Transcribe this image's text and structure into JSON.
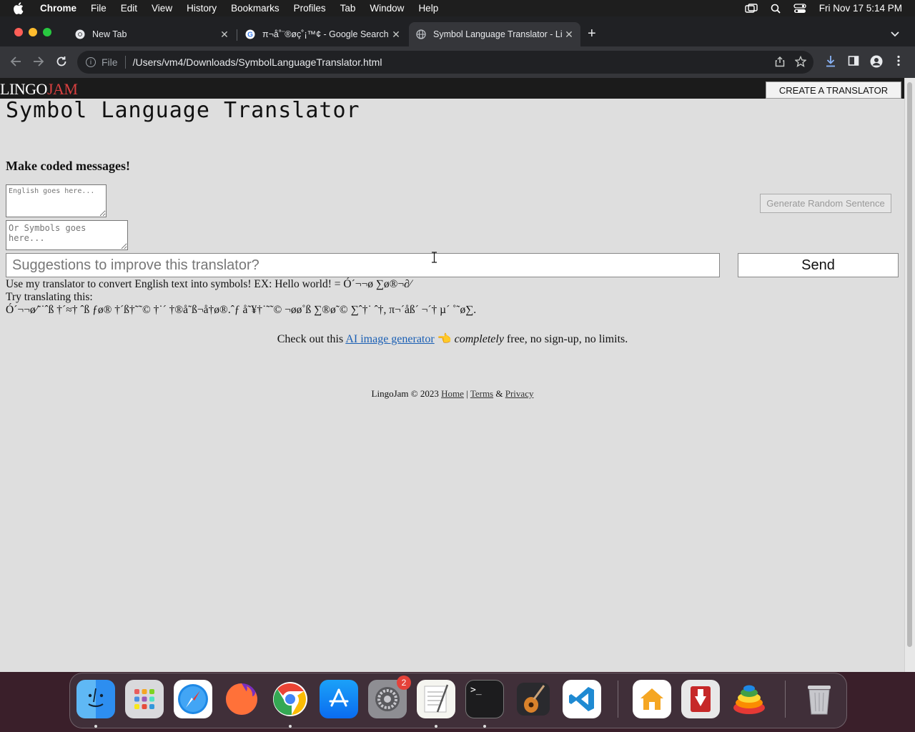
{
  "menubar": {
    "app": "Chrome",
    "items": [
      "File",
      "Edit",
      "View",
      "History",
      "Bookmarks",
      "Profiles",
      "Tab",
      "Window",
      "Help"
    ],
    "clock": "Fri Nov 17  5:14 PM"
  },
  "tabs": [
    {
      "title": "New Tab",
      "icon": "chrome-icon"
    },
    {
      "title": "π¬å˚¨®øç˚¡™¢ - Google Search",
      "icon": "google-icon"
    },
    {
      "title": "Symbol Language Translator - LingoJam",
      "icon": "globe-icon",
      "active": true
    }
  ],
  "address": {
    "scheme": "File",
    "url": "/Users/vm4/Downloads/SymbolLanguageTranslator.html"
  },
  "site": {
    "logo_white": "LINGO",
    "logo_red": "JAM",
    "create_button": "CREATE A TRANSLATOR",
    "title": "Symbol Language Translator",
    "subtitle": "Make coded messages!",
    "english_placeholder": "English goes here...",
    "symbols_placeholder": "Or Symbols goes here...",
    "generate_button": "Generate Random Sentence",
    "suggest_placeholder": "Suggestions to improve this translator?",
    "send_button": "Send",
    "description": "Use my translator to convert English text into symbols! EX: Hello world! = Ó´¬¬ø ∑ø®¬∂⁄",
    "try_label": "Try translating this:",
    "sample": "Ó´¬¬ø⁄˜˙ˆß †´≈† ˆß ƒø® †´ß†˜˜© †˙´ †®å˜ß¬å†ø®.ˆƒ å˜¥†˙˜˜© ¬øø˚ß ∑®ø˜© ∑ˆ†˙ ˆ†, π¬´åß´ ¬´† µ´ ˚˜ø∑.",
    "promo_before": "Check out this ",
    "promo_link": "AI image generator",
    "promo_emoji": "👈",
    "promo_em": "completely",
    "promo_after": " free, no sign-up, no limits.",
    "footer_text": "LingoJam © 2023 ",
    "footer_home": "Home",
    "footer_sep": " | ",
    "footer_terms": "Terms",
    "footer_amp": " & ",
    "footer_privacy": "Privacy"
  },
  "dock": {
    "apps": [
      "finder",
      "launchpad",
      "safari",
      "firefox",
      "chrome",
      "app-store",
      "system-settings",
      "textedit",
      "terminal",
      "garageband",
      "vscode",
      "home",
      "downloader",
      "stack-app",
      "trash"
    ],
    "settings_badge": "2",
    "terminal_prompt": ">_"
  },
  "colors": {
    "logo_red": "#d94040",
    "link": "#1a5fb4",
    "page_bg": "#dedede"
  }
}
